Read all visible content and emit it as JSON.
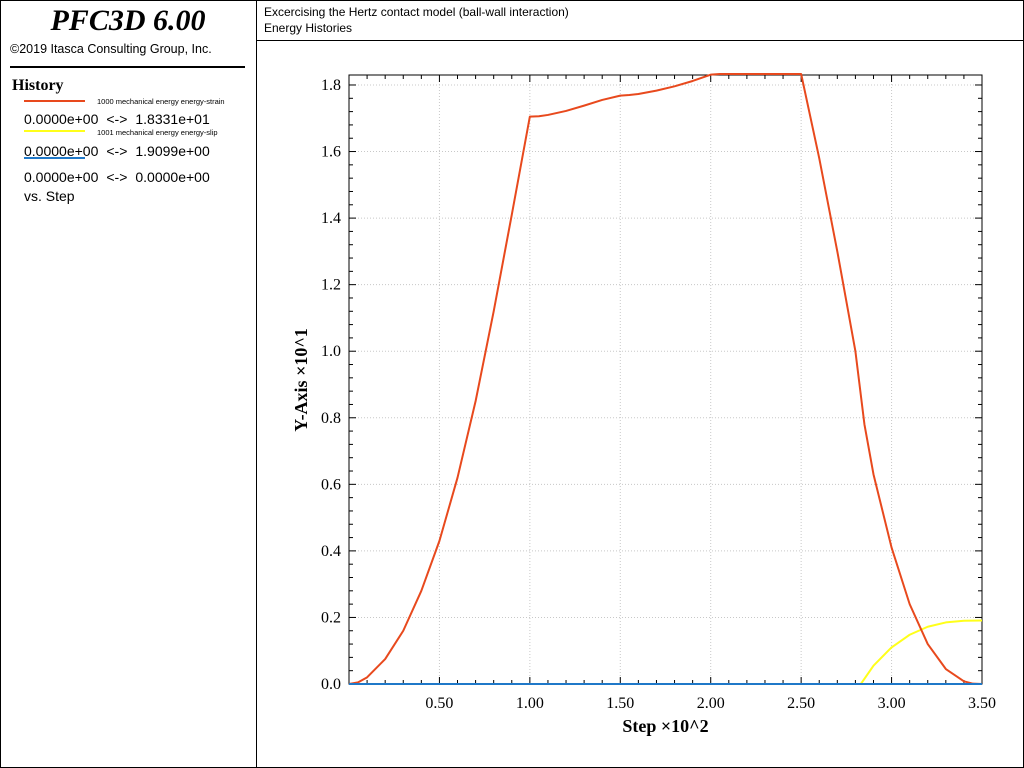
{
  "app": {
    "logo": "PFC3D 6.00",
    "copyright": "©2019 Itasca Consulting Group, Inc."
  },
  "header": {
    "title": "Excercising the Hertz contact model (ball-wall interaction)",
    "subtitle": "Energy Histories"
  },
  "legend": {
    "title": "History",
    "entries": [
      {
        "name": "1000 mechanical energy energy-strain",
        "range_min": "0.0000e+00",
        "range_max": "1.8331e+01",
        "color": "#e8491d"
      },
      {
        "name": "1001 mechanical energy energy-slip",
        "range_min": "0.0000e+00",
        "range_max": "1.9099e+00",
        "color": "#ffff1a"
      },
      {
        "name": "",
        "range_min": "0.0000e+00",
        "range_max": "0.0000e+00",
        "color": "#1f78c8"
      }
    ],
    "arrow": "<->",
    "vs_label": "vs. Step"
  },
  "chart_data": {
    "type": "line",
    "xlabel": "Step ×10^2",
    "ylabel": "Y-Axis ×10^1",
    "xlim": [
      0,
      3.5
    ],
    "ylim": [
      0,
      1.83
    ],
    "x_ticks": [
      0.5,
      1.0,
      1.5,
      2.0,
      2.5,
      3.0,
      3.5
    ],
    "x_tick_labels": [
      "0.50",
      "1.00",
      "1.50",
      "2.00",
      "2.50",
      "3.00",
      "3.50"
    ],
    "y_ticks": [
      0,
      0.2,
      0.4,
      0.6,
      0.8,
      1.0,
      1.2,
      1.4,
      1.6,
      1.8
    ],
    "y_tick_labels": [
      "0.0",
      "0.2",
      "0.4",
      "0.6",
      "0.8",
      "1.0",
      "1.2",
      "1.4",
      "1.6",
      "1.8"
    ],
    "grid": true,
    "series": [
      {
        "name": "1000 mechanical energy energy-strain",
        "color": "#e8491d",
        "x": [
          0,
          0.05,
          0.1,
          0.2,
          0.3,
          0.4,
          0.5,
          0.6,
          0.7,
          0.8,
          0.9,
          1.0,
          1.05,
          1.1,
          1.2,
          1.3,
          1.4,
          1.5,
          1.55,
          1.6,
          1.7,
          1.8,
          1.9,
          2.0,
          2.05,
          2.1,
          2.2,
          2.3,
          2.4,
          2.5,
          2.6,
          2.7,
          2.8,
          2.85,
          2.9,
          3.0,
          3.1,
          3.2,
          3.3,
          3.4,
          3.45,
          3.5
        ],
        "y": [
          0,
          0.005,
          0.02,
          0.075,
          0.16,
          0.28,
          0.43,
          0.62,
          0.85,
          1.12,
          1.41,
          1.705,
          1.706,
          1.71,
          1.722,
          1.738,
          1.755,
          1.768,
          1.77,
          1.773,
          1.783,
          1.796,
          1.812,
          1.831,
          1.833,
          1.833,
          1.833,
          1.833,
          1.833,
          1.833,
          1.58,
          1.3,
          1.0,
          0.78,
          0.63,
          0.41,
          0.24,
          0.12,
          0.045,
          0.008,
          0.001,
          0
        ]
      },
      {
        "name": "1001 mechanical energy energy-slip",
        "color": "#ffff1a",
        "x": [
          0,
          2.83,
          2.9,
          3.0,
          3.1,
          3.2,
          3.3,
          3.4,
          3.5
        ],
        "y": [
          0,
          0,
          0.055,
          0.11,
          0.148,
          0.172,
          0.185,
          0.19,
          0.191
        ]
      },
      {
        "name": "",
        "color": "#1f78c8",
        "x": [
          0,
          3.5
        ],
        "y": [
          0,
          0
        ]
      }
    ]
  }
}
